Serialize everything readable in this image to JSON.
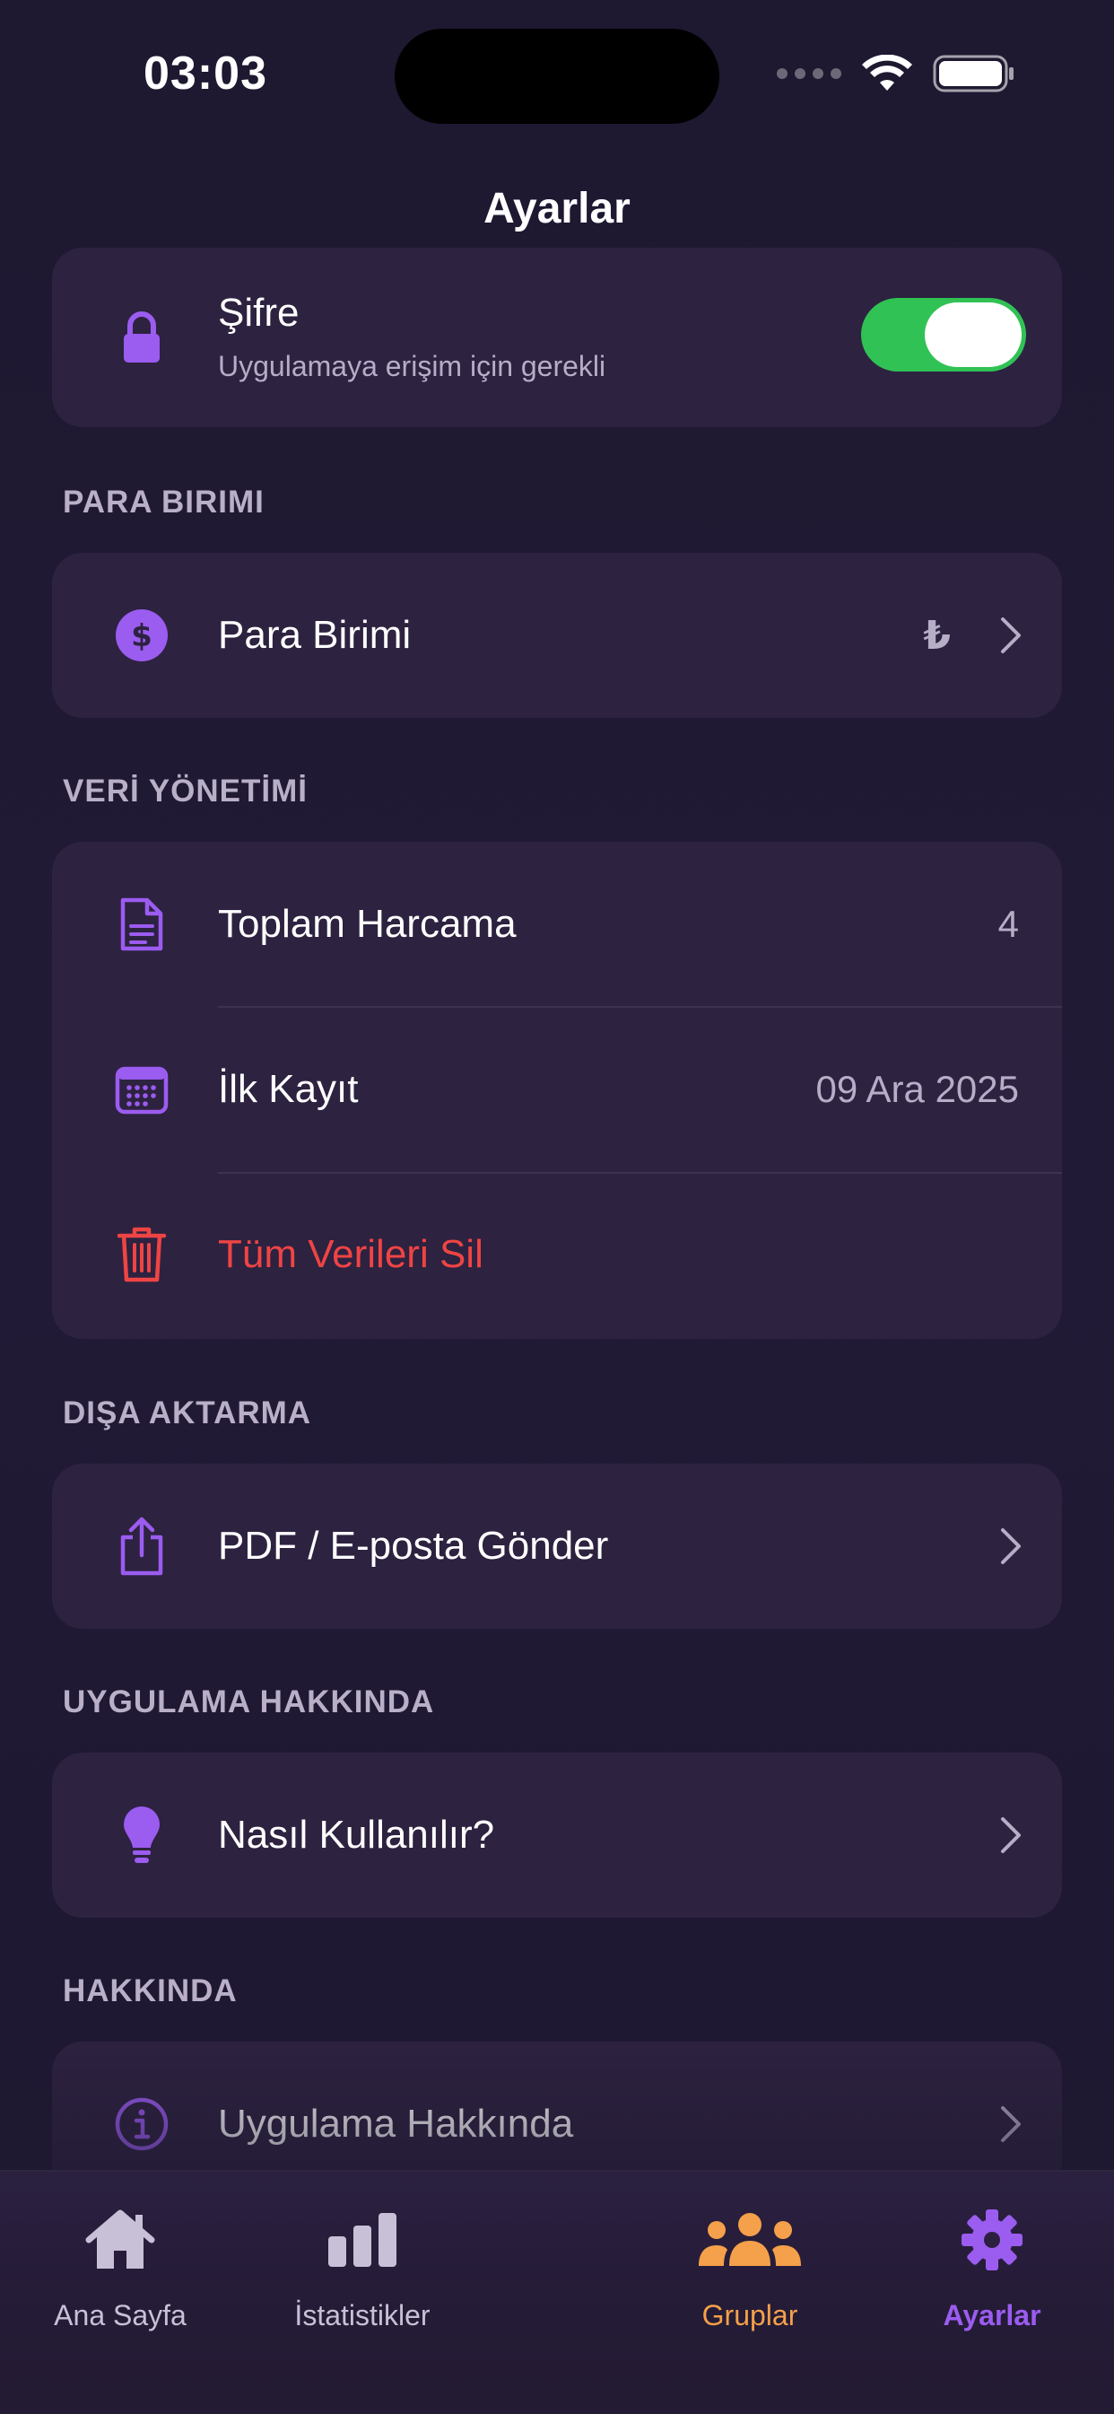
{
  "status_bar": {
    "time": "03:03"
  },
  "page": {
    "title": "Ayarlar"
  },
  "colors": {
    "accent": "#9b5cf0",
    "danger": "#ef4444",
    "toggle_on": "#30c254",
    "groups_orange": "#f5a04a",
    "card_bg": "#2d2240"
  },
  "security": {
    "password": {
      "icon": "lock-icon",
      "label": "Şifre",
      "sublabel": "Uygulamaya erişim için gerekli",
      "enabled": true
    }
  },
  "currency": {
    "header": "PARA BIRIMI",
    "label": "Para Birimi",
    "value": "₺",
    "icon": "dollar-circle-icon"
  },
  "data_management": {
    "header": "VERİ YÖNETİMİ",
    "items": [
      {
        "icon": "document-icon",
        "label": "Toplam Harcama",
        "value": "4"
      },
      {
        "icon": "calendar-icon",
        "label": "İlk Kayıt",
        "value": "09 Ara 2025"
      },
      {
        "icon": "trash-icon",
        "label": "Tüm Verileri Sil"
      }
    ]
  },
  "export": {
    "header": "DIŞA AKTARMA",
    "label": "PDF / E-posta Gönder",
    "icon": "share-icon"
  },
  "app_about": {
    "header": "UYGULAMA HAKKINDA",
    "label": "Nasıl Kullanılır?",
    "icon": "lightbulb-icon"
  },
  "about": {
    "header": "HAKKINDA",
    "label": "Uygulama Hakkında",
    "icon": "info-icon"
  },
  "tabbar": {
    "items": [
      {
        "label": "Ana Sayfa",
        "icon": "home-icon"
      },
      {
        "label": "İstatistikler",
        "icon": "bar-chart-icon"
      },
      {
        "label": "Gruplar",
        "icon": "group-icon"
      },
      {
        "label": "Ayarlar",
        "icon": "gear-icon",
        "active": true
      }
    ]
  }
}
